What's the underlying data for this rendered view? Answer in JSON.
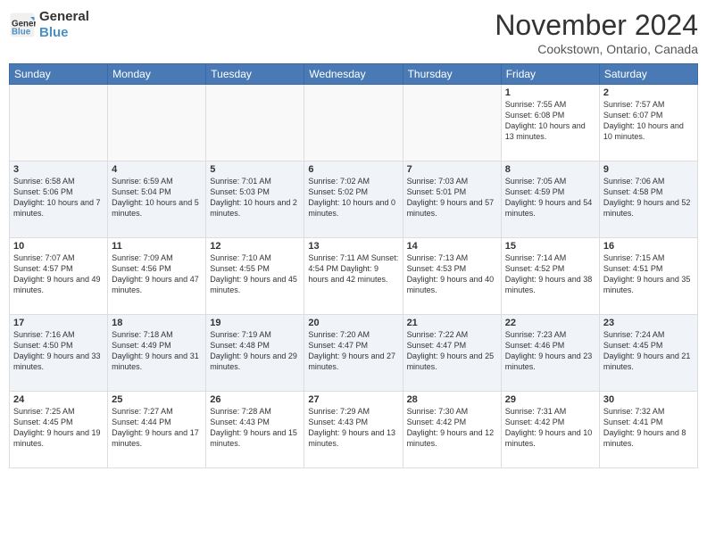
{
  "header": {
    "logo_line1": "General",
    "logo_line2": "Blue",
    "month_title": "November 2024",
    "location": "Cookstown, Ontario, Canada"
  },
  "weekdays": [
    "Sunday",
    "Monday",
    "Tuesday",
    "Wednesday",
    "Thursday",
    "Friday",
    "Saturday"
  ],
  "weeks": [
    [
      {
        "day": "",
        "info": ""
      },
      {
        "day": "",
        "info": ""
      },
      {
        "day": "",
        "info": ""
      },
      {
        "day": "",
        "info": ""
      },
      {
        "day": "",
        "info": ""
      },
      {
        "day": "1",
        "info": "Sunrise: 7:55 AM\nSunset: 6:08 PM\nDaylight: 10 hours and 13 minutes."
      },
      {
        "day": "2",
        "info": "Sunrise: 7:57 AM\nSunset: 6:07 PM\nDaylight: 10 hours and 10 minutes."
      }
    ],
    [
      {
        "day": "3",
        "info": "Sunrise: 6:58 AM\nSunset: 5:06 PM\nDaylight: 10 hours and 7 minutes."
      },
      {
        "day": "4",
        "info": "Sunrise: 6:59 AM\nSunset: 5:04 PM\nDaylight: 10 hours and 5 minutes."
      },
      {
        "day": "5",
        "info": "Sunrise: 7:01 AM\nSunset: 5:03 PM\nDaylight: 10 hours and 2 minutes."
      },
      {
        "day": "6",
        "info": "Sunrise: 7:02 AM\nSunset: 5:02 PM\nDaylight: 10 hours and 0 minutes."
      },
      {
        "day": "7",
        "info": "Sunrise: 7:03 AM\nSunset: 5:01 PM\nDaylight: 9 hours and 57 minutes."
      },
      {
        "day": "8",
        "info": "Sunrise: 7:05 AM\nSunset: 4:59 PM\nDaylight: 9 hours and 54 minutes."
      },
      {
        "day": "9",
        "info": "Sunrise: 7:06 AM\nSunset: 4:58 PM\nDaylight: 9 hours and 52 minutes."
      }
    ],
    [
      {
        "day": "10",
        "info": "Sunrise: 7:07 AM\nSunset: 4:57 PM\nDaylight: 9 hours and 49 minutes."
      },
      {
        "day": "11",
        "info": "Sunrise: 7:09 AM\nSunset: 4:56 PM\nDaylight: 9 hours and 47 minutes."
      },
      {
        "day": "12",
        "info": "Sunrise: 7:10 AM\nSunset: 4:55 PM\nDaylight: 9 hours and 45 minutes."
      },
      {
        "day": "13",
        "info": "Sunrise: 7:11 AM\nSunset: 4:54 PM\nDaylight: 9 hours and 42 minutes."
      },
      {
        "day": "14",
        "info": "Sunrise: 7:13 AM\nSunset: 4:53 PM\nDaylight: 9 hours and 40 minutes."
      },
      {
        "day": "15",
        "info": "Sunrise: 7:14 AM\nSunset: 4:52 PM\nDaylight: 9 hours and 38 minutes."
      },
      {
        "day": "16",
        "info": "Sunrise: 7:15 AM\nSunset: 4:51 PM\nDaylight: 9 hours and 35 minutes."
      }
    ],
    [
      {
        "day": "17",
        "info": "Sunrise: 7:16 AM\nSunset: 4:50 PM\nDaylight: 9 hours and 33 minutes."
      },
      {
        "day": "18",
        "info": "Sunrise: 7:18 AM\nSunset: 4:49 PM\nDaylight: 9 hours and 31 minutes."
      },
      {
        "day": "19",
        "info": "Sunrise: 7:19 AM\nSunset: 4:48 PM\nDaylight: 9 hours and 29 minutes."
      },
      {
        "day": "20",
        "info": "Sunrise: 7:20 AM\nSunset: 4:47 PM\nDaylight: 9 hours and 27 minutes."
      },
      {
        "day": "21",
        "info": "Sunrise: 7:22 AM\nSunset: 4:47 PM\nDaylight: 9 hours and 25 minutes."
      },
      {
        "day": "22",
        "info": "Sunrise: 7:23 AM\nSunset: 4:46 PM\nDaylight: 9 hours and 23 minutes."
      },
      {
        "day": "23",
        "info": "Sunrise: 7:24 AM\nSunset: 4:45 PM\nDaylight: 9 hours and 21 minutes."
      }
    ],
    [
      {
        "day": "24",
        "info": "Sunrise: 7:25 AM\nSunset: 4:45 PM\nDaylight: 9 hours and 19 minutes."
      },
      {
        "day": "25",
        "info": "Sunrise: 7:27 AM\nSunset: 4:44 PM\nDaylight: 9 hours and 17 minutes."
      },
      {
        "day": "26",
        "info": "Sunrise: 7:28 AM\nSunset: 4:43 PM\nDaylight: 9 hours and 15 minutes."
      },
      {
        "day": "27",
        "info": "Sunrise: 7:29 AM\nSunset: 4:43 PM\nDaylight: 9 hours and 13 minutes."
      },
      {
        "day": "28",
        "info": "Sunrise: 7:30 AM\nSunset: 4:42 PM\nDaylight: 9 hours and 12 minutes."
      },
      {
        "day": "29",
        "info": "Sunrise: 7:31 AM\nSunset: 4:42 PM\nDaylight: 9 hours and 10 minutes."
      },
      {
        "day": "30",
        "info": "Sunrise: 7:32 AM\nSunset: 4:41 PM\nDaylight: 9 hours and 8 minutes."
      }
    ]
  ]
}
